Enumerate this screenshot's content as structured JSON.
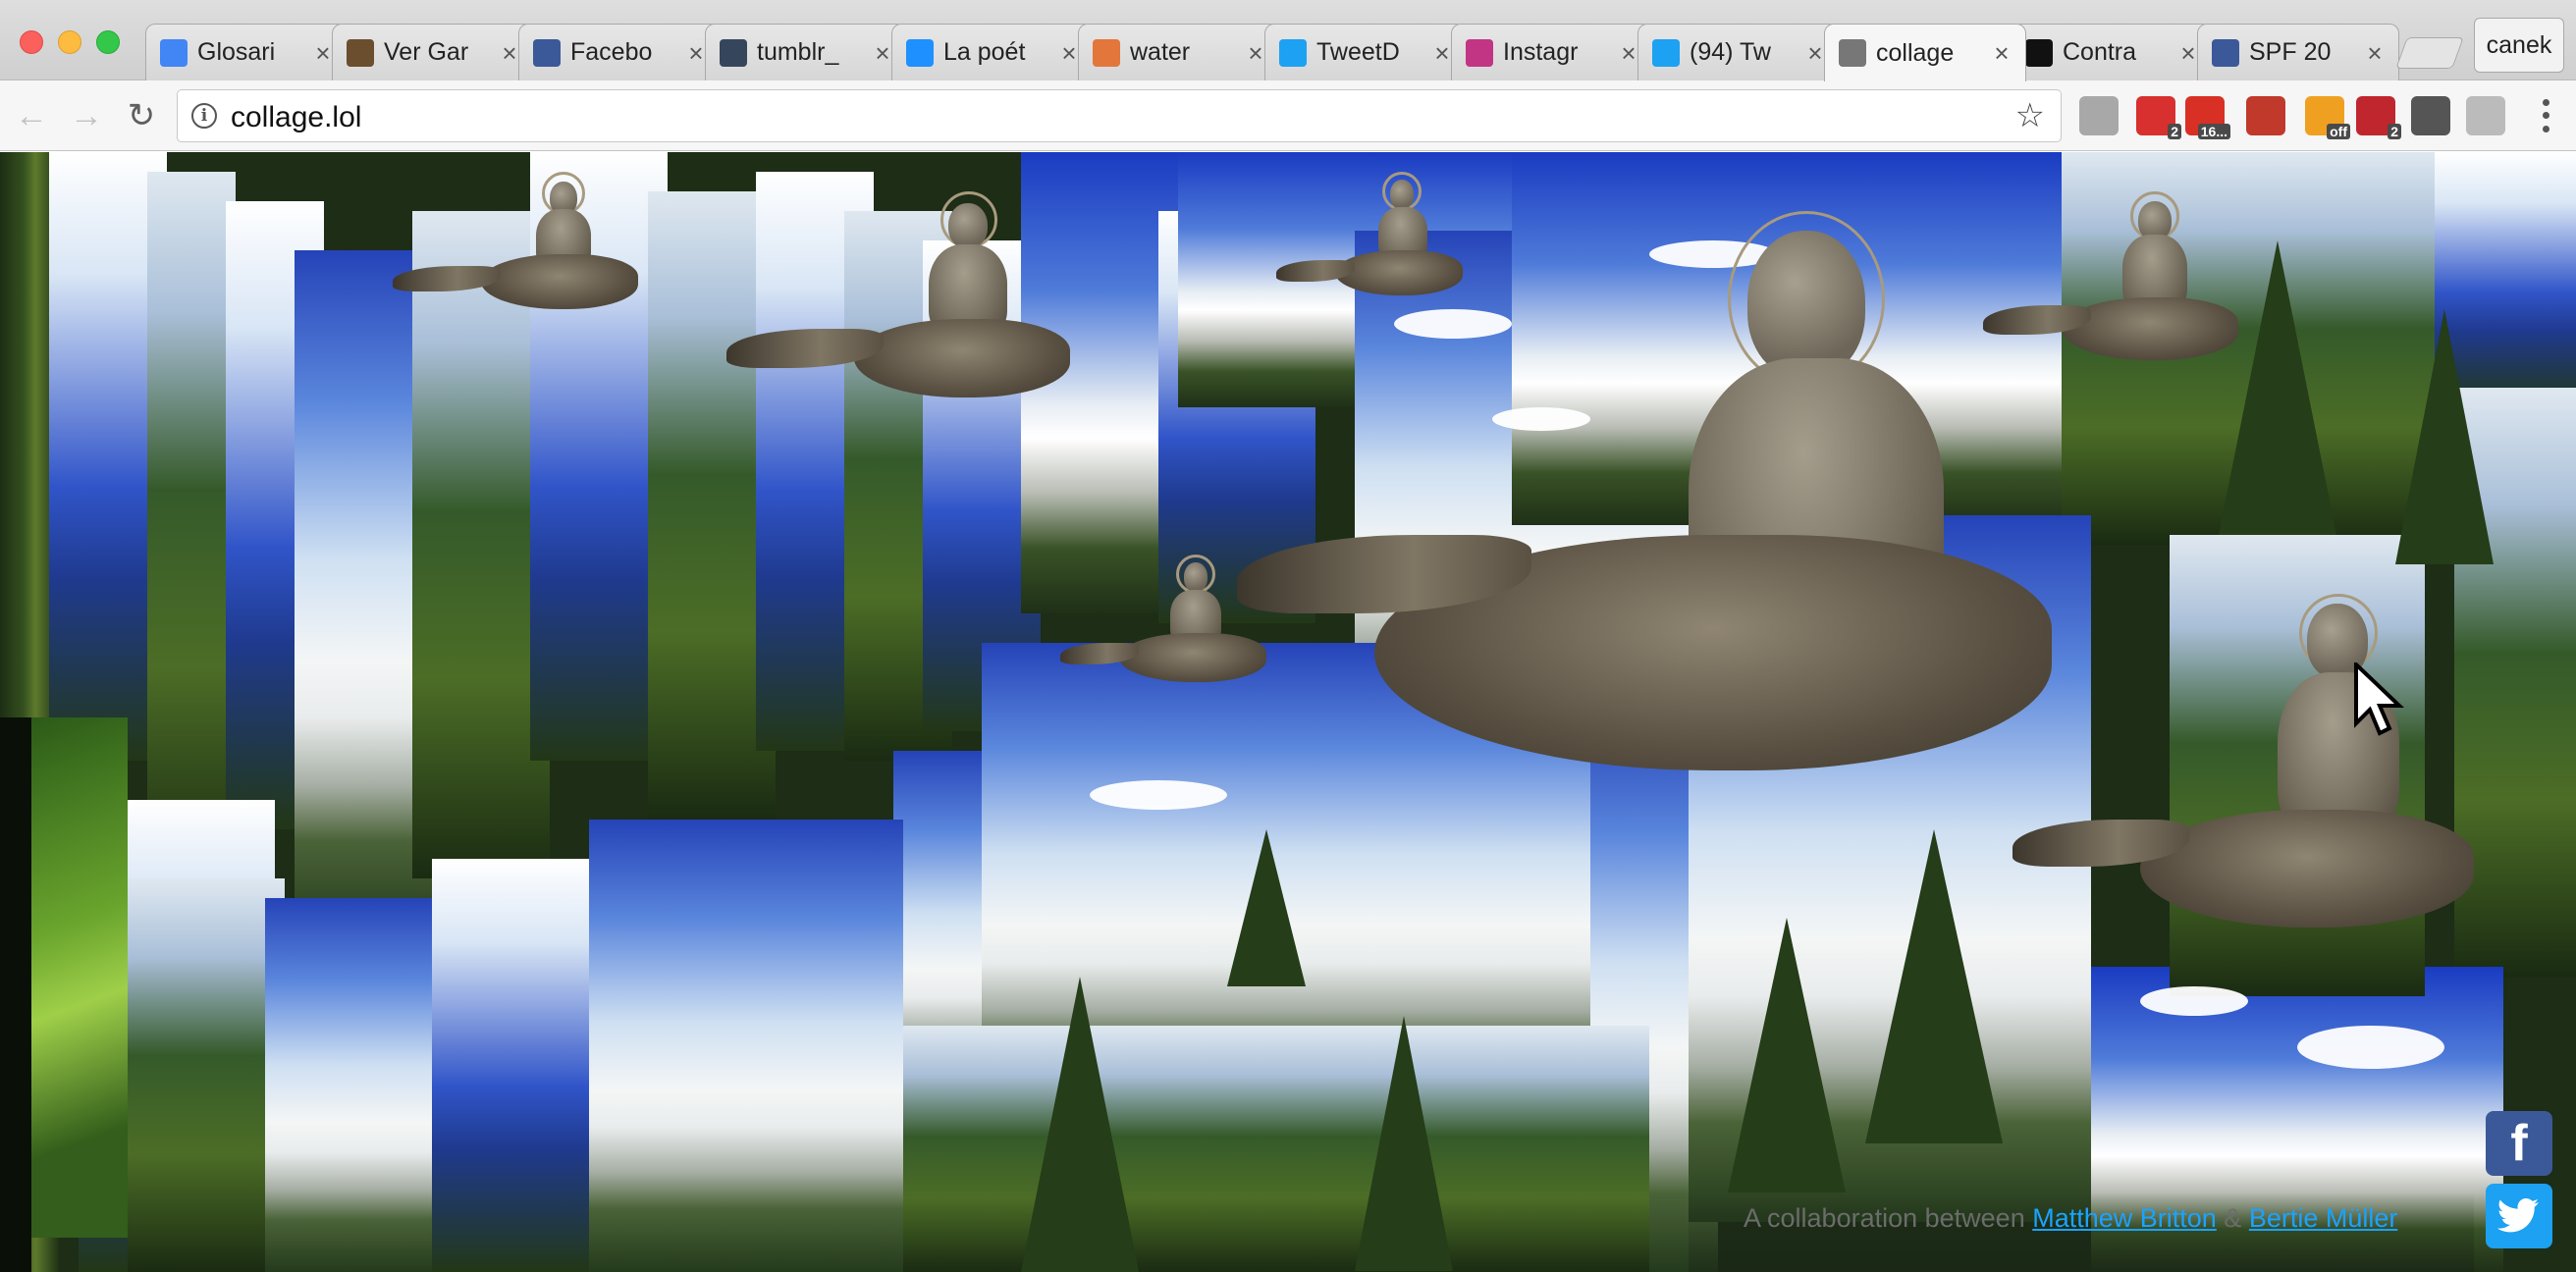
{
  "window": {
    "profile_name": "canek"
  },
  "tabs": [
    {
      "label": "Glosari",
      "icon": "docs-icon",
      "color": "#4285f4"
    },
    {
      "label": "Ver Gar",
      "icon": "film-icon",
      "color": "#6b4e2e"
    },
    {
      "label": "Facebo",
      "icon": "facebook-icon",
      "color": "#3b5998"
    },
    {
      "label": "tumblr_",
      "icon": "tumblr-icon",
      "color": "#35465c"
    },
    {
      "label": "La poét",
      "icon": "triangle-icon",
      "color": "#1e90ff"
    },
    {
      "label": "water",
      "icon": "stack-icon",
      "color": "#e3763a"
    },
    {
      "label": "TweetD",
      "icon": "tweetdeck-icon",
      "color": "#1da1f2"
    },
    {
      "label": "Instagr",
      "icon": "instagram-icon",
      "color": "#c13584"
    },
    {
      "label": "(94) Tw",
      "icon": "twitter-icon",
      "color": "#1da1f2"
    },
    {
      "label": "collage",
      "icon": "page-icon",
      "color": "#777777",
      "active": true
    },
    {
      "label": "Contra",
      "icon": "e-icon",
      "color": "#111111"
    },
    {
      "label": "SPF 20",
      "icon": "facebook-icon",
      "color": "#3b5998"
    }
  ],
  "toolbar": {
    "url": "collage.lol"
  },
  "extensions": [
    {
      "name": "drive-icon",
      "color": "#a8a8a8",
      "badge": ""
    },
    {
      "name": "pocket-icon",
      "color": "#d7302e",
      "badge": "2"
    },
    {
      "name": "gmail-icon",
      "color": "#d93025",
      "badge": "16..."
    },
    {
      "name": "bookmark-icon",
      "color": "#c0392b",
      "badge": ""
    },
    {
      "name": "off-icon",
      "color": "#f0a020",
      "badge": "off"
    },
    {
      "name": "adblock-icon",
      "color": "#c0262d",
      "badge": "2"
    },
    {
      "name": "layout-icon",
      "color": "#555555",
      "badge": ""
    },
    {
      "name": "puzzle-icon",
      "color": "#bbbbbb",
      "badge": ""
    }
  ],
  "page": {
    "credit_prefix": "A collaboration between ",
    "author1": "Matthew Britton",
    "separator": " & ",
    "author2": "Bertie Müller"
  },
  "social": {
    "facebook": "f",
    "twitter": "🐦"
  }
}
